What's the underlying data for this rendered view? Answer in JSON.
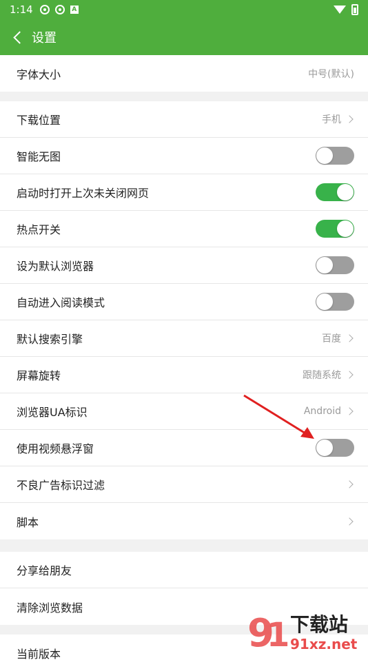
{
  "status_bar": {
    "time": "1:14",
    "a_badge": "A"
  },
  "app_bar": {
    "title": "设置"
  },
  "group1": [
    {
      "label": "字体大小",
      "value": "中号(默认)"
    }
  ],
  "group2": [
    {
      "label": "下载位置",
      "type": "link",
      "value": "手机"
    },
    {
      "label": "智能无图",
      "type": "toggle",
      "on": false
    },
    {
      "label": "启动时打开上次未关闭网页",
      "type": "toggle",
      "on": true
    },
    {
      "label": "热点开关",
      "type": "toggle",
      "on": true
    },
    {
      "label": "设为默认浏览器",
      "type": "toggle",
      "on": false
    },
    {
      "label": "自动进入阅读模式",
      "type": "toggle",
      "on": false
    },
    {
      "label": "默认搜索引擎",
      "type": "link",
      "value": "百度"
    },
    {
      "label": "屏幕旋转",
      "type": "link",
      "value": "跟随系统"
    },
    {
      "label": "浏览器UA标识",
      "type": "link",
      "value": "Android"
    },
    {
      "label": "使用视频悬浮窗",
      "type": "toggle",
      "on": false
    },
    {
      "label": "不良广告标识过滤",
      "type": "link",
      "value": ""
    },
    {
      "label": "脚本",
      "type": "link",
      "value": ""
    }
  ],
  "group3": [
    {
      "label": "分享给朋友"
    },
    {
      "label": "清除浏览数据"
    }
  ],
  "group4": [
    {
      "label": "当前版本"
    }
  ],
  "watermark": {
    "line1": "下载站",
    "line2": "91xz.net"
  },
  "colors": {
    "accent": "#4fae3d",
    "toggle_on": "#38b24a",
    "toggle_off": "#9e9e9e",
    "arrow": "#e02020"
  }
}
